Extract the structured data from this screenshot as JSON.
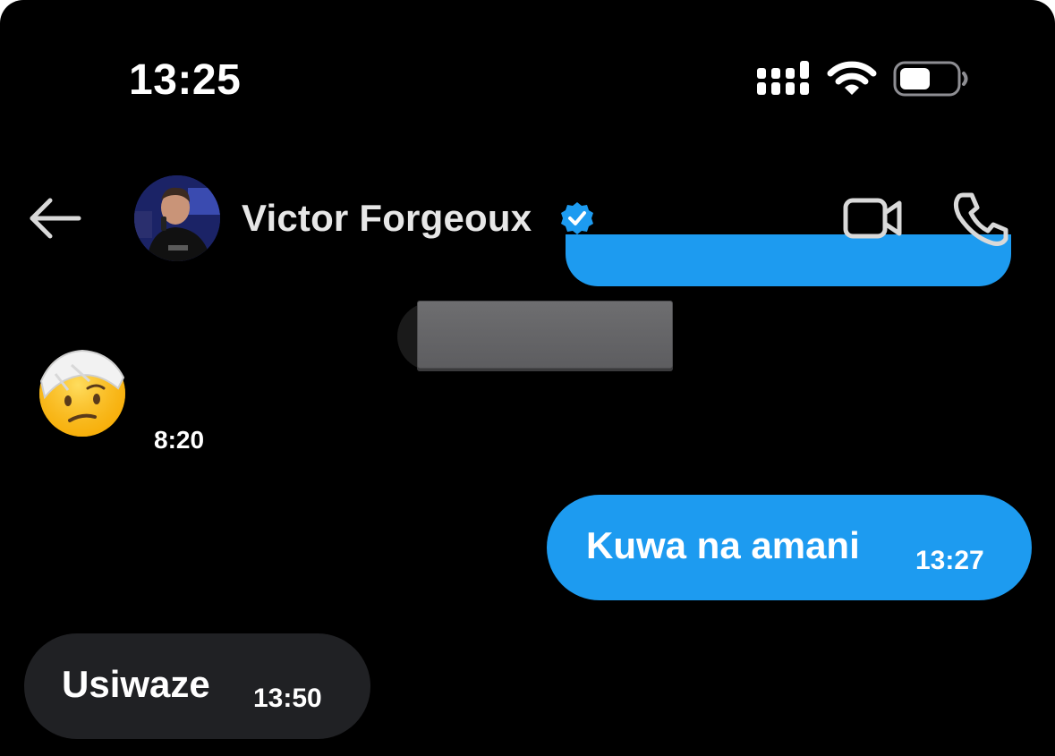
{
  "status_bar": {
    "time": "13:25",
    "signal_icon": "signal-icon",
    "wifi_icon": "wifi-icon",
    "battery_icon": "battery-icon",
    "battery_level": 0.55
  },
  "header": {
    "back_icon": "arrow-left-icon",
    "contact_name": "Victor Forgeoux",
    "verified_icon": "verified-badge-icon",
    "video_icon": "video-camera-icon",
    "call_icon": "phone-icon"
  },
  "messages": [
    {
      "direction": "incoming",
      "type": "media-redacted"
    },
    {
      "direction": "incoming",
      "type": "emoji",
      "emoji": "🤕",
      "time": "8:20"
    },
    {
      "direction": "outgoing",
      "type": "text",
      "text": "Kuwa na amani",
      "time": "13:27"
    },
    {
      "direction": "incoming",
      "type": "text",
      "text": "Usiwaze",
      "time": "13:50"
    }
  ],
  "colors": {
    "background": "#000000",
    "outgoing_bubble": "#1d9bf0",
    "incoming_bubble": "#202124",
    "verified_blue": "#1d9bf0"
  }
}
